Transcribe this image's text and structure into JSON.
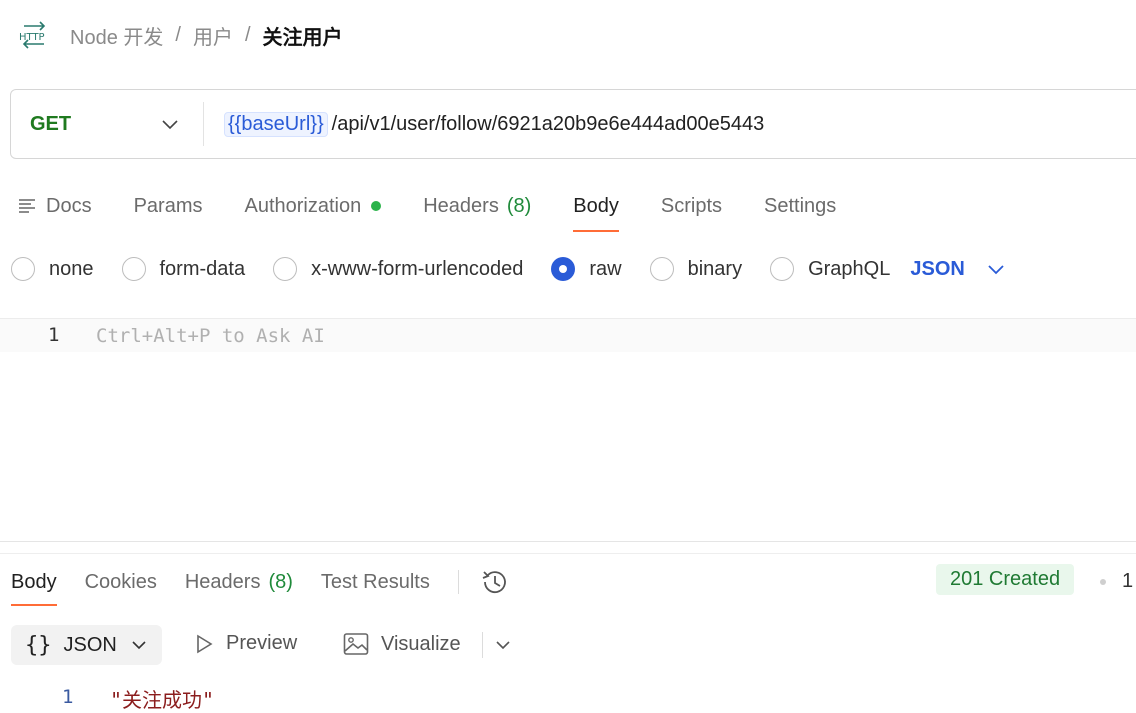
{
  "breadcrumb": {
    "collection": "Node 开发",
    "folder": "用户",
    "current": "关注用户",
    "separator": "/"
  },
  "request": {
    "method": "GET",
    "url_variable": "{{baseUrl}}",
    "url_path": "/api/v1/user/follow/6921a20b9e6e444ad00e5443"
  },
  "request_tabs": {
    "docs": "Docs",
    "params": "Params",
    "authorization": "Authorization",
    "headers": "Headers",
    "headers_count": "(8)",
    "body": "Body",
    "scripts": "Scripts",
    "settings": "Settings",
    "active": "Body"
  },
  "body_types": {
    "options": [
      "none",
      "form-data",
      "x-www-form-urlencoded",
      "raw",
      "binary",
      "GraphQL"
    ],
    "selected": "raw",
    "format": "JSON"
  },
  "editor": {
    "line_number": "1",
    "placeholder": "Ctrl+Alt+P to Ask AI"
  },
  "response": {
    "tabs": {
      "body": "Body",
      "cookies": "Cookies",
      "headers": "Headers",
      "headers_count": "(8)",
      "test_results": "Test Results"
    },
    "status": "201 Created",
    "trailing": "1",
    "format": "JSON",
    "preview": "Preview",
    "visualize": "Visualize",
    "line_number": "1",
    "value": "\"关注成功\""
  },
  "colors": {
    "accent_tab": "#ff6c37",
    "method_get": "#1f7a1f",
    "link_blue": "#2a5bd7",
    "status_green": "#1f7a33"
  }
}
